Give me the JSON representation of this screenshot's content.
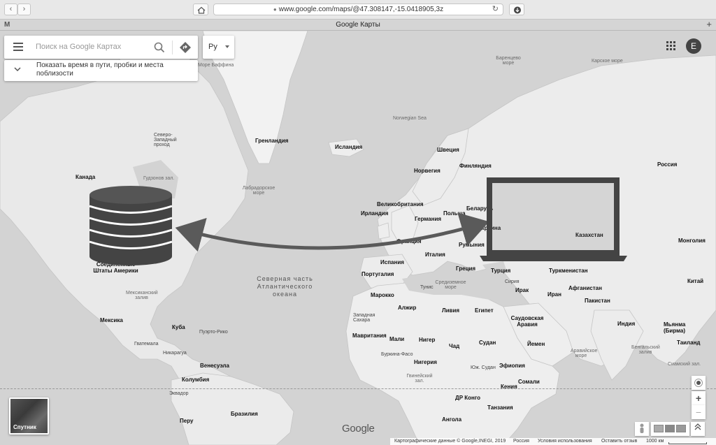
{
  "browser": {
    "url": "www.google.com/maps/@47.308147,-15.0418905,3z",
    "tab_title": "Google Карты",
    "back_label": "‹",
    "forward_label": "›",
    "new_tab_label": "+"
  },
  "search": {
    "placeholder": "Поиск на Google Картах",
    "lang_label": "Ру",
    "travel_text": "Показать время в пути, пробки и места поблизости"
  },
  "account": {
    "avatar_letter": "E"
  },
  "satellite": {
    "label": "Спутник"
  },
  "logo": "Google",
  "zoom": {
    "in": "+",
    "out": "−"
  },
  "footer": {
    "attribution": "Картографические данные © Google,INEGI, 2019",
    "country": "Россия",
    "terms": "Условия использования",
    "feedback": "Оставить отзыв",
    "scale": "1000 км"
  },
  "map_labels": {
    "greenland": "Гренландия",
    "iceland": "Исландия",
    "canada": "Канада",
    "northwest": "Северо-Западный проход",
    "baffin": "Море Баффина",
    "hudson": "Гудзонов зал.",
    "labrador": "Лабрадорское море",
    "norwegian": "Norwegian Sea",
    "barents": "Баренцево море",
    "kara": "Карское море",
    "sweden": "Швеция",
    "norway": "Норвегия",
    "finland": "Финляндия",
    "russia": "Россия",
    "uk": "Великобритания",
    "ireland": "Ирландия",
    "germany": "Германия",
    "poland": "Польша",
    "belarus": "Беларусь",
    "ukraine": "Украина",
    "kazakhstan": "Казахстан",
    "mongolia": "Монголия",
    "france": "Франция",
    "romania": "Румыния",
    "italy": "Италия",
    "spain": "Испания",
    "portugal": "Португалия",
    "greece": "Греция",
    "turkey": "Турция",
    "turkmenistan": "Туркменистан",
    "china": "Китай",
    "atlantic": "Северная часть Атлантического океана",
    "usa": "Соединенные Штаты Америки",
    "mexico": "Мексика",
    "mexgulf": "Мексиканский залив",
    "cuba": "Куба",
    "puerto": "Пуэрто-Рико",
    "guatemala": "Гватемала",
    "nicaragua": "Никарагуа",
    "venezuela": "Венесуэла",
    "colombia": "Колумбия",
    "ecuador": "Эквадор",
    "peru": "Перу",
    "brazil": "Бразилия",
    "morocco": "Марокко",
    "algeria": "Алжир",
    "libya": "Ливия",
    "egypt": "Египет",
    "tunisia": "Тунис",
    "medsea": "Средиземное море",
    "wsahara": "Западная Сахара",
    "mauritania": "Мавритания",
    "mali": "Мали",
    "niger": "Нигер",
    "chad": "Чад",
    "sudan": "Судан",
    "nigeria": "Нигерия",
    "burkina": "Буркина-Фасо",
    "ssudan": "Юж. Судан",
    "ethiopia": "Эфиопия",
    "somalia": "Сомали",
    "kenya": "Кения",
    "drc": "ДР Конго",
    "tanzania": "Танзания",
    "angola": "Ангола",
    "guinea": "Гвинейский зал.",
    "saudi": "Саудовская Аравия",
    "yemen": "Йемен",
    "iraq": "Ирак",
    "iran": "Иран",
    "syria": "Сирия",
    "afghanistan": "Афганистан",
    "pakistan": "Пакистан",
    "india": "Индия",
    "myanmar": "Мьянма (Бирма)",
    "thailand": "Таиланд",
    "bengal": "Бенгальский залив",
    "arabian": "Аравийское море",
    "siam": "Сиамский зал."
  }
}
